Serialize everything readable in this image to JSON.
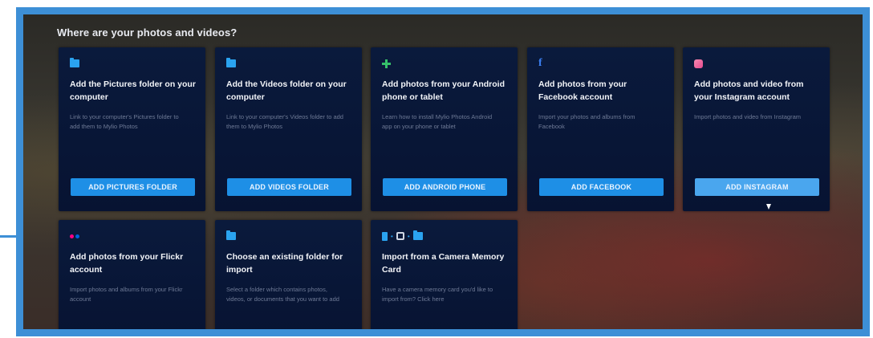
{
  "heading": "Where are your photos and videos?",
  "cards": [
    {
      "icon": "folder-icon",
      "title": "Add the Pictures folder on your computer",
      "description": "Link to your computer's Pictures folder to add them to Mylio Photos",
      "button": "ADD PICTURES FOLDER"
    },
    {
      "icon": "folder-icon",
      "title": "Add the Videos folder on your computer",
      "description": "Link to your computer's Videos folder to add them to Mylio Photos",
      "button": "ADD VIDEOS FOLDER"
    },
    {
      "icon": "android-icon",
      "title": "Add photos from your Android phone or tablet",
      "description": "Learn how to install Mylio Photos Android app on your phone or tablet",
      "button": "ADD ANDROID PHONE"
    },
    {
      "icon": "facebook-icon",
      "title": "Add photos from your Facebook account",
      "description": "Import your photos and albums from Facebook",
      "button": "ADD FACEBOOK"
    },
    {
      "icon": "instagram-icon",
      "title": "Add photos and video from your Instagram account",
      "description": "Import photos and video from Instagram",
      "button": "ADD INSTAGRAM"
    },
    {
      "icon": "flickr-icon",
      "title": "Add photos from your Flickr account",
      "description": "Import photos and albums from your Flickr account"
    },
    {
      "icon": "folder-icon",
      "title": "Choose an existing folder for import",
      "description": "Select a folder which contains photos, videos, or documents that you want to add"
    },
    {
      "icon": "camera-card-import-icon",
      "title": "Import from a Camera Memory Card",
      "description": "Have a camera memory card you'd like to import from? Click here"
    }
  ],
  "colors": {
    "frame_border": "#3d8fd6",
    "card_bg": "#0a1a3c",
    "button_bg": "#1e8fe6",
    "button_hover_bg": "#4aa6ee",
    "flickr_pink": "#ff0084",
    "flickr_blue": "#0063dc"
  }
}
